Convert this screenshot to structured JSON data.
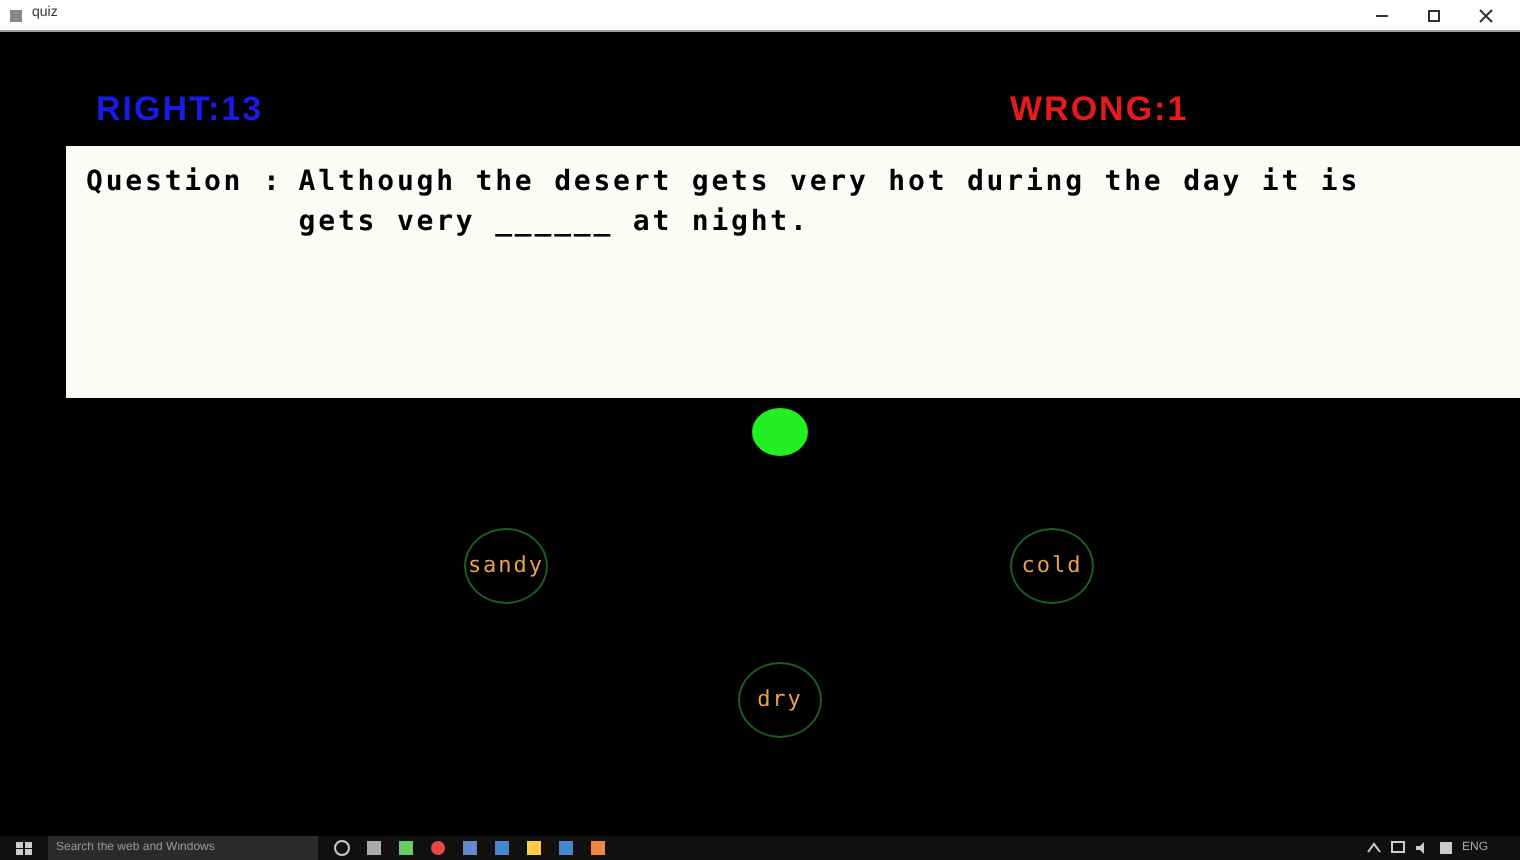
{
  "window": {
    "title": "quiz"
  },
  "score": {
    "right": "RIGHT:13",
    "wrong": "WRONG:1"
  },
  "question": {
    "label": "Question :",
    "text": "Although the desert gets very hot during the day it is gets very ______ at night."
  },
  "options": [
    {
      "label": "sandy"
    },
    {
      "label": "cold"
    },
    {
      "label": "dry"
    }
  ],
  "taskbar": {
    "search": {
      "placeholder": "Search the web and Windows"
    },
    "language": "ENG"
  }
}
